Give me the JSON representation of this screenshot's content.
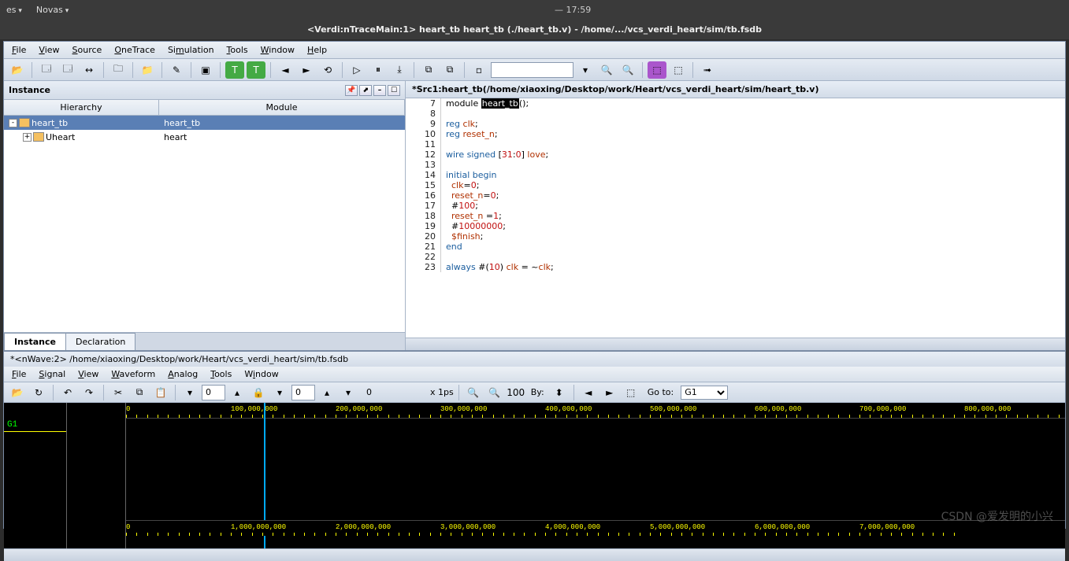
{
  "desktop": {
    "menu1": "es",
    "menu2": "Novas",
    "time": "— 17:59"
  },
  "window": {
    "title": "<Verdi:nTraceMain:1> heart_tb heart_tb (./heart_tb.v) - /home/.../vcs_verdi_heart/sim/tb.fsdb"
  },
  "menubar": [
    "File",
    "View",
    "Source",
    "OneTrace",
    "Simulation",
    "Tools",
    "Window",
    "Help"
  ],
  "instancePane": {
    "title": "Instance",
    "cols": [
      "Hierarchy",
      "Module"
    ],
    "rows": [
      {
        "indent": 0,
        "exp": "-",
        "icon": true,
        "name": "heart_tb",
        "mod": "heart_tb",
        "sel": true
      },
      {
        "indent": 1,
        "exp": "+",
        "icon": true,
        "name": "Uheart",
        "mod": "heart",
        "sel": false
      }
    ],
    "tabs": [
      "Instance",
      "Declaration"
    ],
    "activeTab": 0
  },
  "source": {
    "title": "*Src1:heart_tb(/home/xiaoxing/Desktop/work/Heart/vcs_verdi_heart/sim/heart_tb.v)",
    "lines": [
      {
        "n": 7,
        "h": "module <hl>heart_tb</hl>();"
      },
      {
        "n": 8,
        "h": ""
      },
      {
        "n": 9,
        "h": "<kw>reg</kw> <id>clk</id>;"
      },
      {
        "n": 10,
        "h": "<kw>reg</kw> <id>reset_n</id>;"
      },
      {
        "n": 11,
        "h": ""
      },
      {
        "n": 12,
        "h": "<kw>wire signed</kw> [<num>31</num>:<num>0</num>] <id>love</id>;"
      },
      {
        "n": 13,
        "h": ""
      },
      {
        "n": 14,
        "h": "<kw>initial</kw> <kw>begin</kw>"
      },
      {
        "n": 15,
        "h": "  <id>clk</id>=<num>0</num>;"
      },
      {
        "n": 16,
        "h": "  <id>reset_n</id>=<num>0</num>;"
      },
      {
        "n": 17,
        "h": "  #<num>100</num>;"
      },
      {
        "n": 18,
        "h": "  <id>reset_n</id> =<num>1</num>;"
      },
      {
        "n": 19,
        "h": "  #<num>10000000</num>;"
      },
      {
        "n": 20,
        "h": "  <id>$finish</id>;"
      },
      {
        "n": 21,
        "h": "<kw>end</kw>"
      },
      {
        "n": 22,
        "h": ""
      },
      {
        "n": 23,
        "h": "<kw>always</kw> #(<num>10</num>) <id>clk</id> = ~<id>clk</id>;"
      }
    ]
  },
  "wave": {
    "title": "*<nWave:2> /home/xiaoxing/Desktop/work/Heart/vcs_verdi_heart/sim/tb.fsdb",
    "menubar": [
      "File",
      "Signal",
      "View",
      "Waveform",
      "Analog",
      "Tools",
      "Window"
    ],
    "spin1": "0",
    "spin2": "0",
    "spin3": "0",
    "timeunit": "x 1ps",
    "goto_label": "Go to:",
    "goto_value": "G1",
    "signal": "G1",
    "rulerTop": [
      "0",
      "100,000,000",
      "200,000,000",
      "300,000,000",
      "400,000,000",
      "500,000,000",
      "600,000,000",
      "700,000,000",
      "800,000,000"
    ],
    "rulerBot": [
      "0",
      "1,000,000,000",
      "2,000,000,000",
      "3,000,000,000",
      "4,000,000,000",
      "5,000,000,000",
      "6,000,000,000",
      "7,000,000,000"
    ]
  },
  "watermark": "CSDN @爱发明的小兴"
}
